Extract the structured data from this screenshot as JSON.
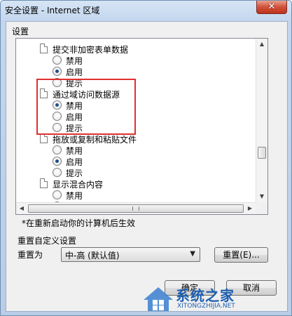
{
  "window": {
    "title": "安全设置 - Internet 区域",
    "close_glyph": "✕"
  },
  "settings_group": {
    "label": "设置"
  },
  "list": {
    "items": [
      {
        "type": "header",
        "label": "提交非加密表单数据"
      },
      {
        "type": "radio",
        "label": "禁用",
        "checked": false
      },
      {
        "type": "radio",
        "label": "启用",
        "checked": true
      },
      {
        "type": "radio",
        "label": "提示",
        "checked": false
      },
      {
        "type": "header",
        "label": "通过域访问数据源"
      },
      {
        "type": "radio",
        "label": "禁用",
        "checked": true
      },
      {
        "type": "radio",
        "label": "启用",
        "checked": false
      },
      {
        "type": "radio",
        "label": "提示",
        "checked": false
      },
      {
        "type": "header",
        "label": "拖放或复制和粘贴文件"
      },
      {
        "type": "radio",
        "label": "禁用",
        "checked": false
      },
      {
        "type": "radio",
        "label": "启用",
        "checked": true
      },
      {
        "type": "radio",
        "label": "提示",
        "checked": false
      },
      {
        "type": "header",
        "label": "显示混合内容"
      },
      {
        "type": "radio",
        "label": "禁用",
        "checked": false
      },
      {
        "type": "radio",
        "label": "启用",
        "checked": false
      }
    ]
  },
  "note": "*在重新启动你的计算机后生效",
  "reset_group": {
    "label": "重置自定义设置",
    "reset_to_label": "重置为",
    "selected_level": "中-高 (默认值)",
    "reset_button": "重置(E)..."
  },
  "buttons": {
    "ok": "确定",
    "cancel": "取消"
  },
  "watermark": {
    "text": "系统之家",
    "url": "XITONGZHIJIA.NET"
  },
  "colors": {
    "highlight_box": "#e03030",
    "radio_dot": "#1d4f8a"
  },
  "icons": [
    "close-icon",
    "document-icon",
    "scroll-up-icon",
    "scroll-down-icon",
    "scroll-left-icon",
    "scroll-right-icon",
    "dropdown-caret-icon"
  ]
}
